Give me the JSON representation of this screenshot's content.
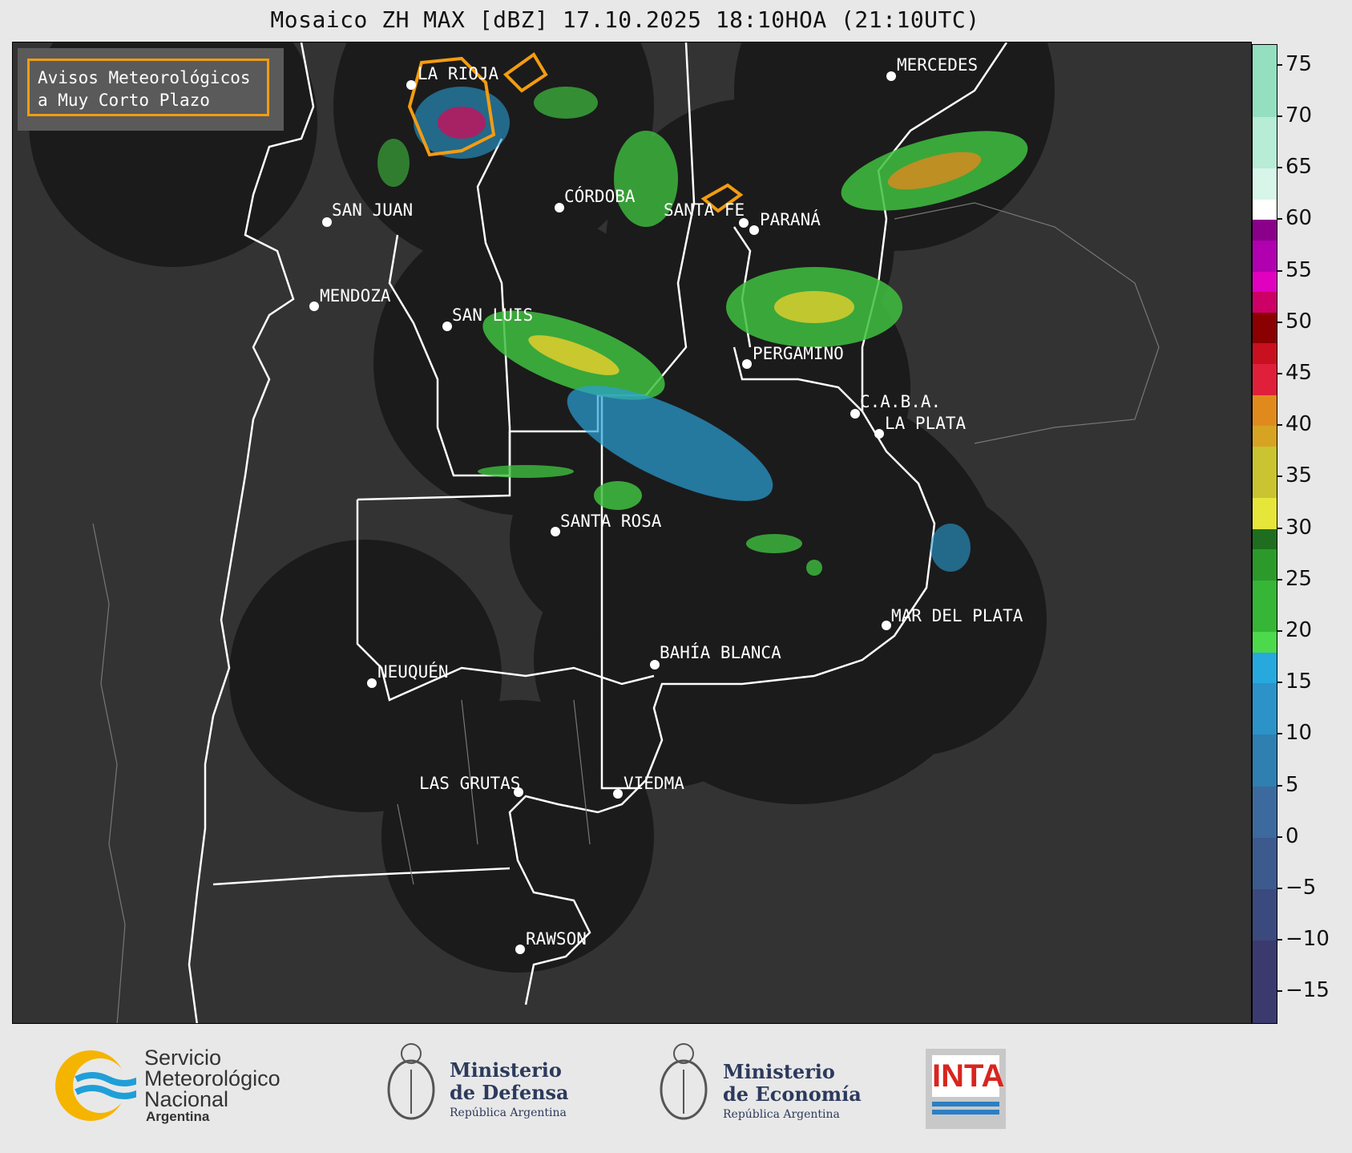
{
  "title": "Mosaico ZH MAX [dBZ] 17.10.2025 18:10HOA (21:10UTC)",
  "legend": {
    "line1": "Avisos Meteorológicos",
    "line2": "a Muy Corto Plazo"
  },
  "cities": [
    {
      "name": "LA RIOJA"
    },
    {
      "name": "MERCEDES"
    },
    {
      "name": "CÓRDOBA"
    },
    {
      "name": "SAN JUAN"
    },
    {
      "name": "SANTA FE"
    },
    {
      "name": "PARANÁ"
    },
    {
      "name": "MENDOZA"
    },
    {
      "name": "SAN LUIS"
    },
    {
      "name": "PERGAMINO"
    },
    {
      "name": "C.A.B.A."
    },
    {
      "name": "LA PLATA"
    },
    {
      "name": "SANTA ROSA"
    },
    {
      "name": "MAR DEL PLATA"
    },
    {
      "name": "BAHÍA BLANCA"
    },
    {
      "name": "NEUQUÉN"
    },
    {
      "name": "LAS GRUTAS"
    },
    {
      "name": "VIEDMA"
    },
    {
      "name": "RAWSON"
    }
  ],
  "colorbar": {
    "ticks": [
      "75",
      "70",
      "65",
      "60",
      "55",
      "50",
      "45",
      "40",
      "35",
      "30",
      "25",
      "20",
      "15",
      "10",
      "5",
      "0",
      "−5",
      "−10",
      "−15"
    ],
    "range": [
      -18,
      77
    ]
  },
  "footer": {
    "smn": {
      "line1": "Servicio",
      "line2": "Meteorológico",
      "line3": "Nacional",
      "line4": "Argentina"
    },
    "defensa": {
      "line1": "Ministerio",
      "line2": "de Defensa",
      "line3": "República Argentina"
    },
    "economia": {
      "line1": "Ministerio",
      "line2": "de Economía",
      "line3": "República Argentina"
    },
    "inta": "INTA"
  },
  "colors": {
    "warning_outline": "#f39c12",
    "map_bg": "#333333",
    "radar_coverage": "#1a1a1a"
  }
}
